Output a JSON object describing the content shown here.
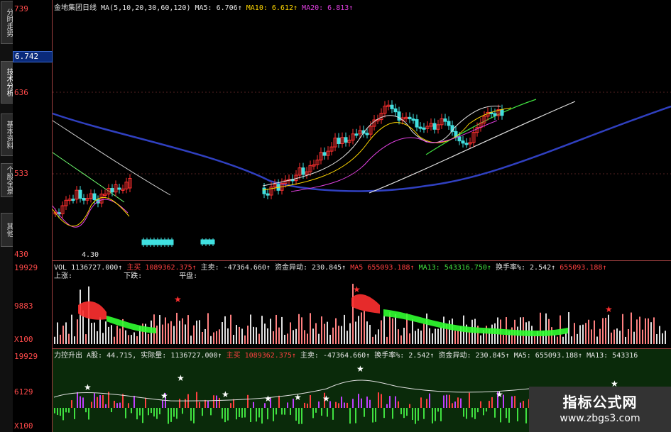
{
  "left_tabs": [
    "分时走势",
    "技术分析",
    "基本资料",
    "个股全景",
    "其他"
  ],
  "price_axis": {
    "top": "739",
    "p636": "636",
    "p533": "533",
    "p430": "430",
    "current": "6.742",
    "low_marker": "4.30"
  },
  "main_header": {
    "title": "金地集团日线",
    "ma_def": "MA(5,10,20,30,60,120)",
    "ma5": "MA5: 6.706↑",
    "ma10": "MA10: 6.612↑",
    "ma20": "MA20: 6.813↑"
  },
  "vol_header": {
    "vol": "VOL 1136727.000↑",
    "buy_label": "主买",
    "buy_val": "1089362.375↑",
    "sell": "主卖: -47364.660↑",
    "fund": "资金异动: 230.845↑",
    "ma5": "MA5 655093.188↑",
    "ma13": "MA13: 543316.750↑",
    "turnover": "换手率%: 2.542↑",
    "extra": "655093.188↑",
    "row2_up": "上涨:",
    "row2_down": "下跌:",
    "row2_flat": "平盘:"
  },
  "vol_axis": {
    "top": "19929",
    "mid": "9883",
    "unit": "X100"
  },
  "force_header": {
    "name": "力控升出",
    "a": "A股: 44.715,",
    "actual": "实际量: 1136727.000↑",
    "buy_label": "主买",
    "buy_val": "1089362.375↑",
    "sell": "主卖: -47364.660↑",
    "turnover": "换手率%: 2.542↑",
    "fund": "资金异动: 230.845↑",
    "ma5": "MA5: 655093.188↑",
    "ma13": "MA13: 543316"
  },
  "force_axis": {
    "top": "19929",
    "mid": "6129",
    "unit": "X100"
  },
  "watermark": {
    "line1": "指标公式网",
    "line2": "www.zbgs3.com"
  },
  "colors": {
    "up": "#ff3030",
    "down": "#40e0e0",
    "ma_long": "#3040c0",
    "green_band": "#30ff30",
    "red_band": "#ff3030"
  }
}
